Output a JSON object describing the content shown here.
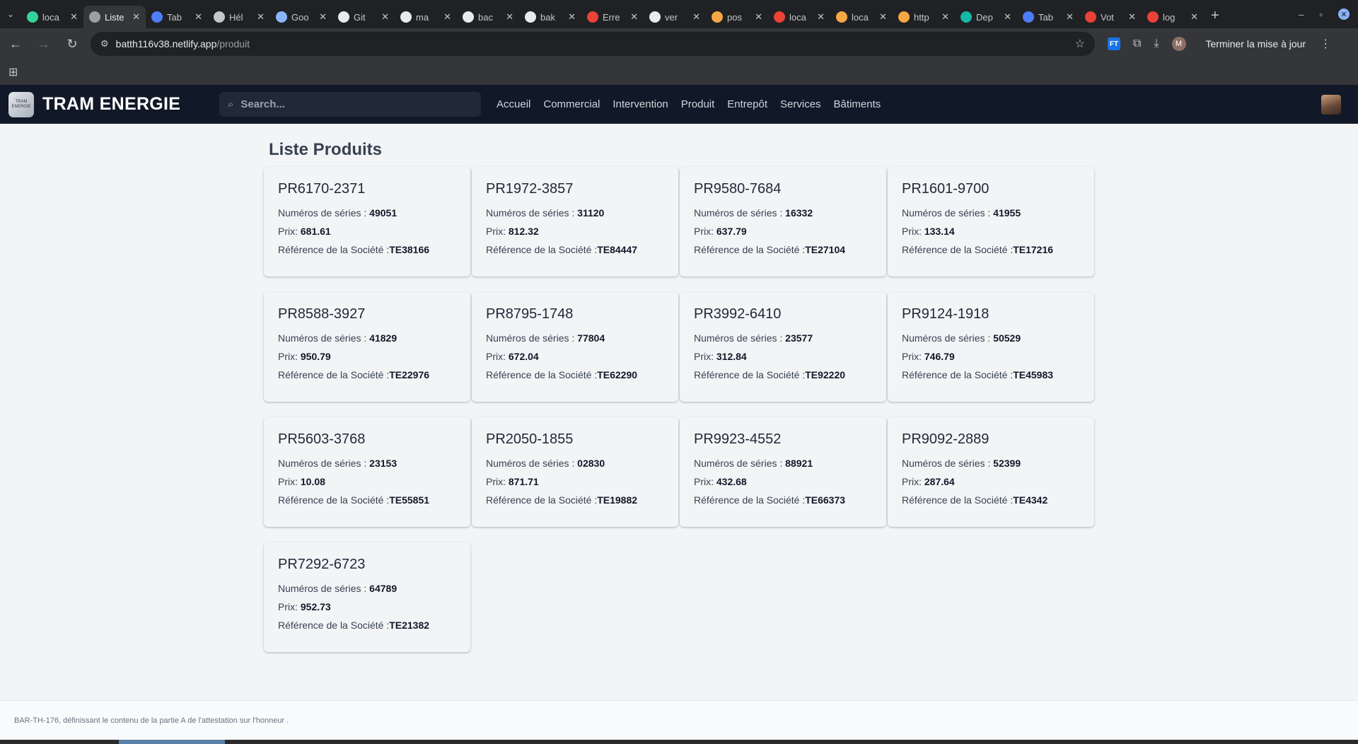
{
  "browser": {
    "tabs": [
      {
        "title": "loca",
        "favicon_color": "#34d399",
        "active": false
      },
      {
        "title": "Liste",
        "favicon_color": "#9aa0a6",
        "active": true
      },
      {
        "title": "Tab",
        "favicon_color": "#4f7cf7",
        "active": false
      },
      {
        "title": "Hél",
        "favicon_color": "#c4c7c5",
        "active": false
      },
      {
        "title": "Goo",
        "favicon_color": "#8ab4f8",
        "active": false
      },
      {
        "title": "Git",
        "favicon_color": "#e8eaed",
        "active": false
      },
      {
        "title": "ma",
        "favicon_color": "#e8eaed",
        "active": false
      },
      {
        "title": "bac",
        "favicon_color": "#e8eaed",
        "active": false
      },
      {
        "title": "bak",
        "favicon_color": "#e8eaed",
        "active": false
      },
      {
        "title": "Erre",
        "favicon_color": "#ea4335",
        "active": false
      },
      {
        "title": "ver",
        "favicon_color": "#e8eaed",
        "active": false
      },
      {
        "title": "pos",
        "favicon_color": "#f4a742",
        "active": false
      },
      {
        "title": "loca",
        "favicon_color": "#ea4335",
        "active": false
      },
      {
        "title": "loca",
        "favicon_color": "#f4a742",
        "active": false
      },
      {
        "title": "http",
        "favicon_color": "#f4a742",
        "active": false
      },
      {
        "title": "Dep",
        "favicon_color": "#14b8a6",
        "active": false
      },
      {
        "title": "Tab",
        "favicon_color": "#4f7cf7",
        "active": false
      },
      {
        "title": "Vot",
        "favicon_color": "#ea4335",
        "active": false
      },
      {
        "title": "log",
        "favicon_color": "#ea4335",
        "active": false
      }
    ],
    "url_host": "batth116v38.netlify.app",
    "url_path": "/produit",
    "ext_label": "FT",
    "profile_initial": "M",
    "update_label": "Terminer la mise à jour"
  },
  "app": {
    "brand": "TRAM ENERGIE",
    "logo_text": "TRAM ENERGIE",
    "search_placeholder": "Search...",
    "nav": [
      "Accueil",
      "Commercial",
      "Intervention",
      "Produit",
      "Entrepôt",
      "Services",
      "Bâtiments"
    ]
  },
  "page": {
    "title": "Liste Produits",
    "labels": {
      "serial": "Numéros de séries : ",
      "price": "Prix: ",
      "ref": "Référence de la Société :"
    },
    "products": [
      {
        "code": "PR6170-2371",
        "serial": "49051",
        "price": "681.61",
        "ref": "TE38166"
      },
      {
        "code": "PR1972-3857",
        "serial": "31120",
        "price": "812.32",
        "ref": "TE84447"
      },
      {
        "code": "PR9580-7684",
        "serial": "16332",
        "price": "637.79",
        "ref": "TE27104"
      },
      {
        "code": "PR1601-9700",
        "serial": "41955",
        "price": "133.14",
        "ref": "TE17216"
      },
      {
        "code": "PR8588-3927",
        "serial": "41829",
        "price": "950.79",
        "ref": "TE22976"
      },
      {
        "code": "PR8795-1748",
        "serial": "77804",
        "price": "672.04",
        "ref": "TE62290"
      },
      {
        "code": "PR3992-6410",
        "serial": "23577",
        "price": "312.84",
        "ref": "TE92220"
      },
      {
        "code": "PR9124-1918",
        "serial": "50529",
        "price": "746.79",
        "ref": "TE45983"
      },
      {
        "code": "PR5603-3768",
        "serial": "23153",
        "price": "10.08",
        "ref": "TE55851"
      },
      {
        "code": "PR2050-1855",
        "serial": "02830",
        "price": "871.71",
        "ref": "TE19882"
      },
      {
        "code": "PR9923-4552",
        "serial": "88921",
        "price": "432.68",
        "ref": "TE66373"
      },
      {
        "code": "PR9092-2889",
        "serial": "52399",
        "price": "287.64",
        "ref": "TE4342"
      },
      {
        "code": "PR7292-6723",
        "serial": "64789",
        "price": "952.73",
        "ref": "TE21382"
      }
    ]
  },
  "footer": {
    "text": "BAR-TH-176, définissant le contenu de la partie A de l'attestation sur l'honneur ."
  }
}
